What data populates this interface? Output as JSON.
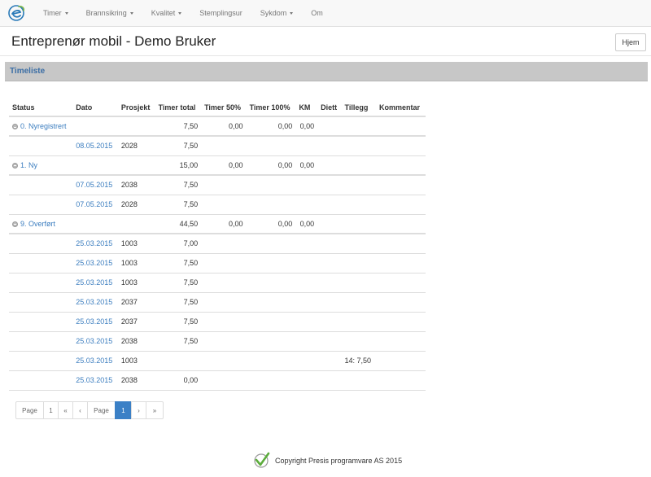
{
  "nav": {
    "items": [
      {
        "label": "Timer",
        "dropdown": true
      },
      {
        "label": "Brannsikring",
        "dropdown": true
      },
      {
        "label": "Kvalitet",
        "dropdown": true
      },
      {
        "label": "Stemplingsur",
        "dropdown": false
      },
      {
        "label": "Sykdom",
        "dropdown": true
      },
      {
        "label": "Om",
        "dropdown": false
      }
    ]
  },
  "header": {
    "title": "Entreprenør mobil - Demo Bruker",
    "home_label": "Hjem"
  },
  "section": {
    "title": "Timeliste"
  },
  "table": {
    "columns": [
      "Status",
      "Dato",
      "Prosjekt",
      "Timer total",
      "Timer 50%",
      "Timer 100%",
      "KM",
      "Diett",
      "Tillegg",
      "Kommentar"
    ],
    "rows": [
      {
        "group": true,
        "status": "0. Nyregistrert",
        "dato": "",
        "prosjekt": "",
        "timer_total": "7,50",
        "timer_50": "0,00",
        "timer_100": "0,00",
        "km": "0,00",
        "diett": "",
        "tillegg": "",
        "kommentar": ""
      },
      {
        "group": false,
        "status": "",
        "dato": "08.05.2015",
        "prosjekt": "2028",
        "timer_total": "7,50",
        "timer_50": "",
        "timer_100": "",
        "km": "",
        "diett": "",
        "tillegg": "",
        "kommentar": ""
      },
      {
        "group": true,
        "status": "1. Ny",
        "dato": "",
        "prosjekt": "",
        "timer_total": "15,00",
        "timer_50": "0,00",
        "timer_100": "0,00",
        "km": "0,00",
        "diett": "",
        "tillegg": "",
        "kommentar": ""
      },
      {
        "group": false,
        "status": "",
        "dato": "07.05.2015",
        "prosjekt": "2038",
        "timer_total": "7,50",
        "timer_50": "",
        "timer_100": "",
        "km": "",
        "diett": "",
        "tillegg": "",
        "kommentar": ""
      },
      {
        "group": false,
        "status": "",
        "dato": "07.05.2015",
        "prosjekt": "2028",
        "timer_total": "7,50",
        "timer_50": "",
        "timer_100": "",
        "km": "",
        "diett": "",
        "tillegg": "",
        "kommentar": ""
      },
      {
        "group": true,
        "status": "9. Overført",
        "dato": "",
        "prosjekt": "",
        "timer_total": "44,50",
        "timer_50": "0,00",
        "timer_100": "0,00",
        "km": "0,00",
        "diett": "",
        "tillegg": "",
        "kommentar": ""
      },
      {
        "group": false,
        "status": "",
        "dato": "25.03.2015",
        "prosjekt": "1003",
        "timer_total": "7,00",
        "timer_50": "",
        "timer_100": "",
        "km": "",
        "diett": "",
        "tillegg": "",
        "kommentar": ""
      },
      {
        "group": false,
        "status": "",
        "dato": "25.03.2015",
        "prosjekt": "1003",
        "timer_total": "7,50",
        "timer_50": "",
        "timer_100": "",
        "km": "",
        "diett": "",
        "tillegg": "",
        "kommentar": ""
      },
      {
        "group": false,
        "status": "",
        "dato": "25.03.2015",
        "prosjekt": "1003",
        "timer_total": "7,50",
        "timer_50": "",
        "timer_100": "",
        "km": "",
        "diett": "",
        "tillegg": "",
        "kommentar": ""
      },
      {
        "group": false,
        "status": "",
        "dato": "25.03.2015",
        "prosjekt": "2037",
        "timer_total": "7,50",
        "timer_50": "",
        "timer_100": "",
        "km": "",
        "diett": "",
        "tillegg": "",
        "kommentar": ""
      },
      {
        "group": false,
        "status": "",
        "dato": "25.03.2015",
        "prosjekt": "2037",
        "timer_total": "7,50",
        "timer_50": "",
        "timer_100": "",
        "km": "",
        "diett": "",
        "tillegg": "",
        "kommentar": ""
      },
      {
        "group": false,
        "status": "",
        "dato": "25.03.2015",
        "prosjekt": "2038",
        "timer_total": "7,50",
        "timer_50": "",
        "timer_100": "",
        "km": "",
        "diett": "",
        "tillegg": "",
        "kommentar": ""
      },
      {
        "group": false,
        "status": "",
        "dato": "25.03.2015",
        "prosjekt": "1003",
        "timer_total": "",
        "timer_50": "",
        "timer_100": "",
        "km": "",
        "diett": "",
        "tillegg": "14: 7,50",
        "kommentar": ""
      },
      {
        "group": false,
        "status": "",
        "dato": "25.03.2015",
        "prosjekt": "2038",
        "timer_total": "0,00",
        "timer_50": "",
        "timer_100": "",
        "km": "",
        "diett": "",
        "tillegg": "",
        "kommentar": ""
      }
    ]
  },
  "pagination": [
    {
      "label": "Page",
      "active": false
    },
    {
      "label": "1",
      "active": false
    },
    {
      "label": "«",
      "active": false
    },
    {
      "label": "‹",
      "active": false
    },
    {
      "label": "Page",
      "active": false
    },
    {
      "label": "1",
      "active": true
    },
    {
      "label": "›",
      "active": false
    },
    {
      "label": "»",
      "active": false
    }
  ],
  "footer": {
    "text": "Copyright Presis programvare AS 2015"
  },
  "colors": {
    "accent": "#3b80c6",
    "link": "#3b7dbf",
    "section_bar": "#c7c7c7"
  },
  "icons": {
    "logo": "e-swoosh-logo-icon",
    "group_toggle": "collapse-minus-icon",
    "footer_logo": "checkmark-logo-icon"
  }
}
